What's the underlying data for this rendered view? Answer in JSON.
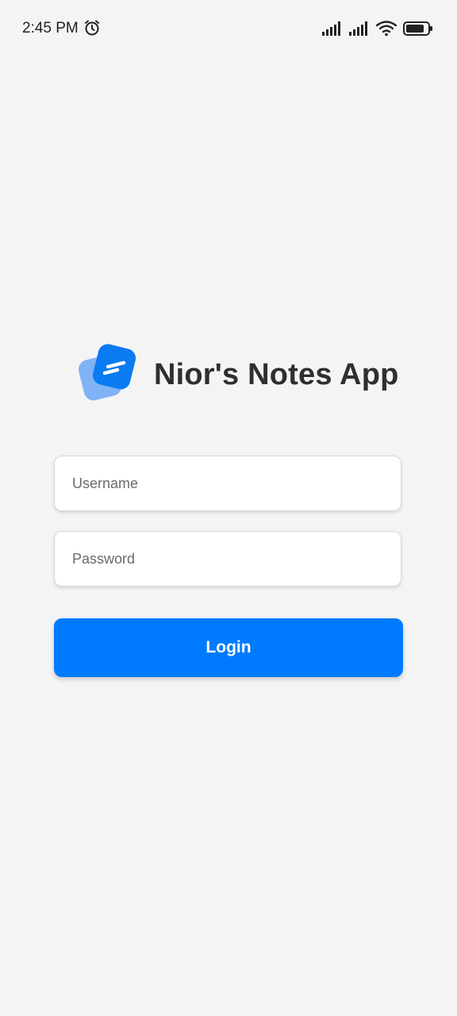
{
  "status_bar": {
    "time": "2:45 PM",
    "icons": [
      "alarm-icon",
      "signal-icon",
      "signal-icon",
      "wifi-icon",
      "battery-icon"
    ]
  },
  "app": {
    "title": "Nior's Notes App",
    "logo_icon": "notes-logo-icon"
  },
  "form": {
    "username_placeholder": "Username",
    "password_placeholder": "Password",
    "login_label": "Login"
  },
  "colors": {
    "background": "#f4f4f4",
    "accent": "#007bff",
    "title": "#2f2f2f"
  }
}
